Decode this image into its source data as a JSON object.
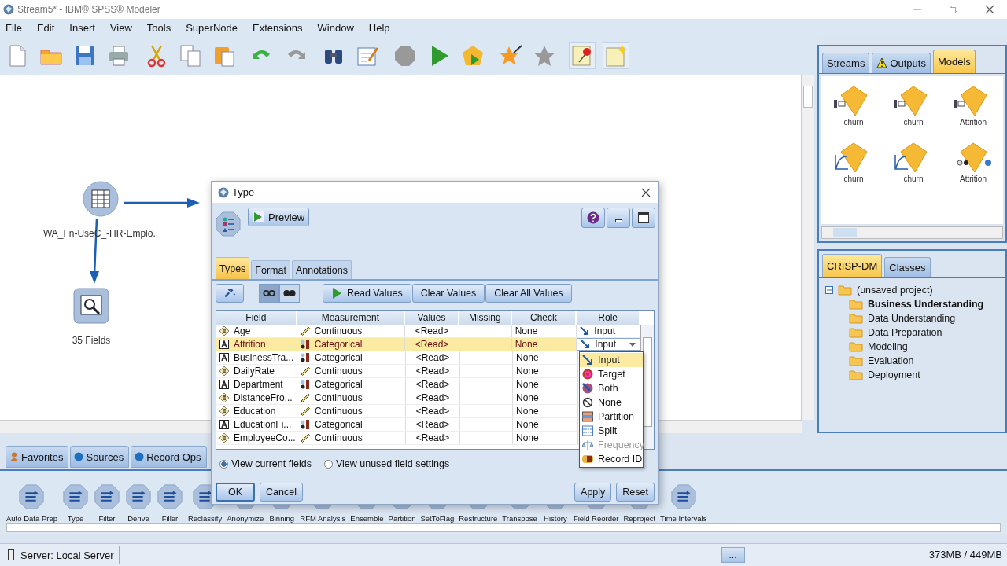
{
  "window": {
    "title": "Stream5* - IBM® SPSS® Modeler"
  },
  "menu": [
    "File",
    "Edit",
    "Insert",
    "View",
    "Tools",
    "SuperNode",
    "Extensions",
    "Window",
    "Help"
  ],
  "canvas": {
    "nodes": [
      {
        "label": "WA_Fn-UseC_-HR-Emplo..",
        "kind": "excel"
      },
      {
        "label": "35 Fields",
        "kind": "table"
      }
    ]
  },
  "right_panel": {
    "tabs": [
      {
        "label": "Streams",
        "selected": false,
        "warning": false
      },
      {
        "label": "Outputs",
        "selected": false,
        "warning": true
      },
      {
        "label": "Models",
        "selected": true,
        "warning": false
      }
    ],
    "models": [
      {
        "label": "churn",
        "kind": "tree"
      },
      {
        "label": "churn",
        "kind": "tree"
      },
      {
        "label": "Attrition",
        "kind": "tree"
      },
      {
        "label": "churn",
        "kind": "curve"
      },
      {
        "label": "churn",
        "kind": "curve"
      },
      {
        "label": "Attrition",
        "kind": "network"
      }
    ],
    "project_tabs": [
      {
        "label": "CRISP-DM",
        "selected": true
      },
      {
        "label": "Classes",
        "selected": false
      }
    ],
    "project": {
      "label": "(unsaved project)",
      "expanded": true,
      "children": [
        {
          "label": "Business Understanding",
          "default": true
        },
        {
          "label": "Data Understanding",
          "default": false
        },
        {
          "label": "Data Preparation",
          "default": false
        },
        {
          "label": "Modeling",
          "default": false
        },
        {
          "label": "Evaluation",
          "default": false
        },
        {
          "label": "Deployment",
          "default": false
        }
      ]
    }
  },
  "palette_tabs": [
    {
      "label": "Favorites",
      "kind": "person"
    },
    {
      "label": "Sources",
      "kind": "dot"
    },
    {
      "label": "Record Ops",
      "kind": "dot"
    }
  ],
  "palette_nodes": [
    "Auto Data Prep",
    "Type",
    "Filter",
    "Derive",
    "Filler",
    "Reclassify",
    "Anonymize",
    "Binning",
    "RFM Analysis",
    "Ensemble",
    "Partition",
    "SetToFlag",
    "Restructure",
    "Transpose",
    "History",
    "Field Reorder",
    "Reproject",
    "Time Intervals"
  ],
  "status_bar": {
    "server": "Server: Local Server",
    "button": "...",
    "memory": "373MB / 449MB"
  },
  "dialog": {
    "title": "Type",
    "preview": "Preview",
    "tabs": [
      {
        "label": "Types",
        "selected": true
      },
      {
        "label": "Format",
        "selected": false
      },
      {
        "label": "Annotations",
        "selected": false
      }
    ],
    "view_toggles": [
      {
        "selected": true
      },
      {
        "selected": false
      }
    ],
    "buttons": [
      "Read Values",
      "Clear Values",
      "Clear All Values"
    ],
    "columns": [
      "Field",
      "Measurement",
      "Values",
      "Missing",
      "Check",
      "Role"
    ],
    "rows": [
      {
        "field": {
          "name": "Age",
          "kind": "number"
        },
        "measurement": {
          "label": "Continuous",
          "kind": "continuous"
        },
        "values": "<Read>",
        "check": "None",
        "role": "Input",
        "selected": false
      },
      {
        "field": {
          "name": "Attrition",
          "kind": "string"
        },
        "measurement": {
          "label": "Categorical",
          "kind": "categorical"
        },
        "values": "<Read>",
        "check": "None",
        "role": "Input",
        "selected": true
      },
      {
        "field": {
          "name": "BusinessTra...",
          "kind": "string"
        },
        "measurement": {
          "label": "Categorical",
          "kind": "categorical"
        },
        "values": "<Read>",
        "check": "None",
        "selected": false
      },
      {
        "field": {
          "name": "DailyRate",
          "kind": "number"
        },
        "measurement": {
          "label": "Continuous",
          "kind": "continuous"
        },
        "values": "<Read>",
        "check": "None",
        "selected": false
      },
      {
        "field": {
          "name": "Department",
          "kind": "string"
        },
        "measurement": {
          "label": "Categorical",
          "kind": "categorical"
        },
        "values": "<Read>",
        "check": "None",
        "selected": false
      },
      {
        "field": {
          "name": "DistanceFro...",
          "kind": "number"
        },
        "measurement": {
          "label": "Continuous",
          "kind": "continuous"
        },
        "values": "<Read>",
        "check": "None",
        "selected": false
      },
      {
        "field": {
          "name": "Education",
          "kind": "number"
        },
        "measurement": {
          "label": "Continuous",
          "kind": "continuous"
        },
        "values": "<Read>",
        "check": "None",
        "selected": false
      },
      {
        "field": {
          "name": "EducationFi...",
          "kind": "string"
        },
        "measurement": {
          "label": "Categorical",
          "kind": "categorical"
        },
        "values": "<Read>",
        "check": "None",
        "selected": false
      },
      {
        "field": {
          "name": "EmployeeCo...",
          "kind": "number"
        },
        "measurement": {
          "label": "Continuous",
          "kind": "continuous"
        },
        "values": "<Read>",
        "check": "None",
        "selected": false
      }
    ],
    "role_options": [
      {
        "label": "Input",
        "kind": "input",
        "selected": true,
        "disabled": false
      },
      {
        "label": "Target",
        "kind": "target",
        "selected": false,
        "disabled": false
      },
      {
        "label": "Both",
        "kind": "both",
        "selected": false,
        "disabled": false
      },
      {
        "label": "None",
        "kind": "none",
        "selected": false,
        "disabled": false
      },
      {
        "label": "Partition",
        "kind": "partition",
        "selected": false,
        "disabled": false
      },
      {
        "label": "Split",
        "kind": "split",
        "selected": false,
        "disabled": false
      },
      {
        "label": "Frequency",
        "kind": "frequency",
        "selected": false,
        "disabled": true
      },
      {
        "label": "Record ID",
        "kind": "recordid",
        "selected": false,
        "disabled": false
      }
    ],
    "radios": [
      {
        "label": "View current fields",
        "selected": true
      },
      {
        "label": "View unused field settings",
        "selected": false
      }
    ],
    "footer_left": [
      "OK",
      "Cancel"
    ],
    "footer_right": [
      "Apply",
      "Reset"
    ]
  }
}
